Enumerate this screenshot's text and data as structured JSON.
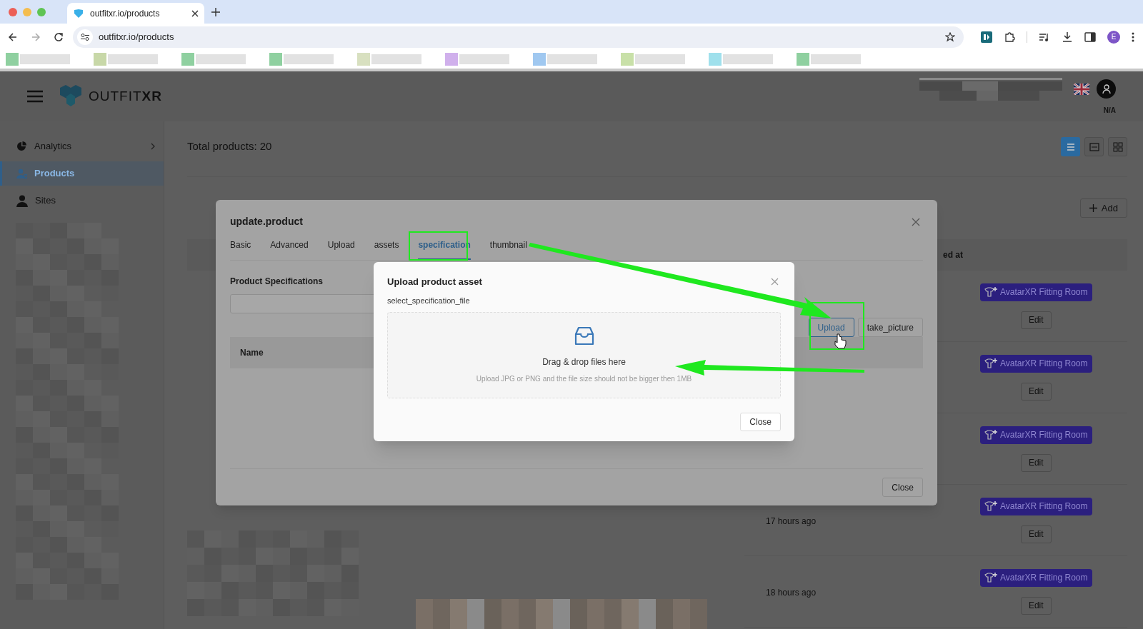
{
  "browser": {
    "tab_title": "outfitxr.io/products",
    "url": "outfitxr.io/products",
    "profile_initial": "E"
  },
  "header": {
    "logo_light": "OUTFIT",
    "logo_bold": "XR",
    "user_label": "N/A"
  },
  "sidebar": {
    "items": [
      {
        "label": "Analytics",
        "selected": false,
        "expandable": true
      },
      {
        "label": "Products",
        "selected": true,
        "expandable": false
      },
      {
        "label": "Sites",
        "selected": false,
        "expandable": false
      }
    ]
  },
  "content": {
    "total": "Total products: 20",
    "view_toggles": [
      {
        "selected": true
      },
      {
        "selected": false
      },
      {
        "selected": false
      }
    ],
    "add_button": "Add",
    "column_partial": "ed at",
    "rows": [
      {
        "badge": "AvatarXR Fitting Room",
        "edit": "Edit"
      },
      {
        "badge": "AvatarXR Fitting Room",
        "edit": "Edit"
      },
      {
        "badge": "AvatarXR Fitting Room",
        "edit": "Edit"
      },
      {
        "badge": "AvatarXR Fitting Room",
        "edit": "Edit",
        "time": "17 hours ago"
      },
      {
        "badge": "AvatarXR Fitting Room",
        "edit": "Edit",
        "time": "18 hours ago"
      }
    ]
  },
  "modal": {
    "title": "update.product",
    "tabs": [
      {
        "label": "Basic",
        "selected": false
      },
      {
        "label": "Advanced",
        "selected": false
      },
      {
        "label": "Upload",
        "selected": false
      },
      {
        "label": "assets",
        "selected": false
      },
      {
        "label": "specification",
        "selected": true
      },
      {
        "label": "thumbnail",
        "selected": false
      }
    ],
    "section_title": "Product Specifications",
    "table_column": "Name",
    "buttons": [
      {
        "label": "Upload",
        "hovered": true
      },
      {
        "label": "take_picture",
        "hovered": false
      }
    ],
    "close": "Close"
  },
  "dialog": {
    "title": "Upload product asset",
    "field_label": "select_specification_file",
    "drop_title": "Drag & drop files here",
    "drop_hint": "Upload JPG or PNG and the file size should not be bigger then 1MB",
    "close": "Close"
  }
}
